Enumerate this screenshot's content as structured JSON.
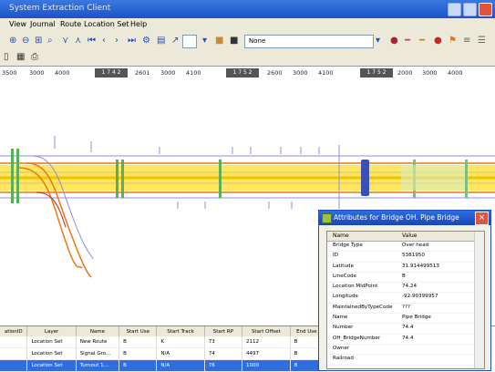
{
  "window": {
    "title": "System Extraction Client"
  },
  "menu": [
    "View",
    "Journal",
    "Route",
    "Location Set",
    "Help"
  ],
  "toolbar": {
    "combo1": "",
    "combo2": "None"
  },
  "ruler": {
    "labels": [
      "3500",
      "3000",
      "4000",
      "2601",
      "3000",
      "4100",
      "2600",
      "3000",
      "4100",
      "2000",
      "3000",
      "4000"
    ],
    "tags": [
      "1 7 4 2",
      "1 7 5 2",
      "1 7 5 2"
    ]
  },
  "colors": {
    "accent": "#1c53c8",
    "track_yellow": "#ffdd22",
    "track_orange": "#ee7711",
    "bridge_blue": "#3a4fb8"
  },
  "grid": {
    "columns": [
      "ationID",
      "Layer",
      "Name",
      "Start Use",
      "Start Track",
      "Start RP",
      "Start Offset",
      "End Use"
    ],
    "rows": [
      [
        "",
        "Location Set",
        "New Route",
        "B",
        "K",
        "73",
        "2112",
        "B"
      ],
      [
        "",
        "Location Set",
        "Signal Gro...",
        "B",
        "N/A",
        "74",
        "4497",
        "B"
      ],
      [
        "",
        "Location Set",
        "Turnout 1...",
        "B",
        "N/A",
        "76",
        "1000",
        "B"
      ]
    ]
  },
  "dialog": {
    "title": "Attributes for Bridge OH. Pipe Bridge",
    "headers": {
      "name": "Name",
      "value": "Value"
    },
    "rows": [
      {
        "name": "Bridge Type",
        "value": "Over head"
      },
      {
        "name": "ID",
        "value": "5381950"
      },
      {
        "name": "Latitude",
        "value": "31.914499513"
      },
      {
        "name": "LineCode",
        "value": "B"
      },
      {
        "name": "Location MidPoint",
        "value": "74.24"
      },
      {
        "name": "Longitude",
        "value": "-92.90399957"
      },
      {
        "name": "MaintainedByTypeCode",
        "value": "???"
      },
      {
        "name": "Name",
        "value": "Pipe Bridge"
      },
      {
        "name": "Number",
        "value": "74.4"
      },
      {
        "name": "OH_BridgeNumber",
        "value": "74.4"
      },
      {
        "name": "Owner",
        "value": ""
      },
      {
        "name": "Railroad",
        "value": ""
      }
    ]
  }
}
